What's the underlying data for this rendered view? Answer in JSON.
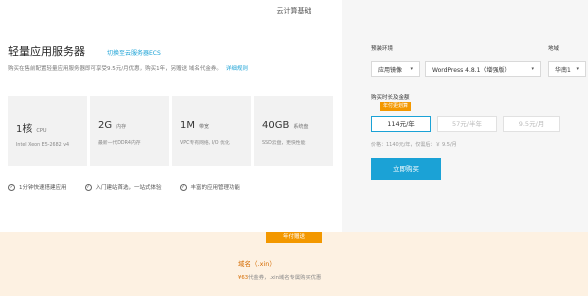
{
  "header": {
    "title": "云计算基础"
  },
  "product": {
    "title": "轻量应用服务器",
    "link": "切换至云服务器ECS",
    "description": "购买在售前配置轻量应用服务器即可享受9.5元/月优惠，购买1年，另赠送 域名代金券。",
    "description_link": "详细规则"
  },
  "specs": [
    {
      "value": "1核",
      "unit": "CPU",
      "sub": "Intel Xeon E5-2682 v4"
    },
    {
      "value": "2G",
      "unit": "内存",
      "sub": "最新一代DDR4内存"
    },
    {
      "value": "1M",
      "unit": "带宽",
      "sub": "VPC专有网络, I/O 优化"
    },
    {
      "value": "40GB",
      "unit": "系统盘",
      "sub": "SSD云盘，更快性能"
    }
  ],
  "features": [
    {
      "label": "1分钟快速搭建应用",
      "icon": "check-circle-icon"
    },
    {
      "label": "入门建站首选，一站式体验",
      "icon": "check-circle-icon"
    },
    {
      "label": "丰富的应用管理功能",
      "icon": "check-circle-icon"
    }
  ],
  "config": {
    "env_label": "预装环境",
    "region_label": "地域",
    "image_select": "应用镜像",
    "app_select": "WordPress 4.8.1（增强版）",
    "region_select": "华南1",
    "duration_label": "购买时长及金额",
    "hot_tag": "年付更划算",
    "durations": [
      "114元/年",
      "57元/半年",
      "9.5元/月"
    ],
    "price_line": "价格：1140元/年，仅需后：￥ 9.5/月",
    "buy_label": "立即购买"
  },
  "promo": {
    "tag": "年付赠送",
    "title": "域名（.xin）",
    "desc_highlight": "¥63",
    "desc_rest": "代金券，.xin域名专属购买优惠"
  },
  "colors": {
    "accent": "#1ba2d6",
    "orange": "#f39800",
    "promo_bg": "#fdf1e2"
  }
}
